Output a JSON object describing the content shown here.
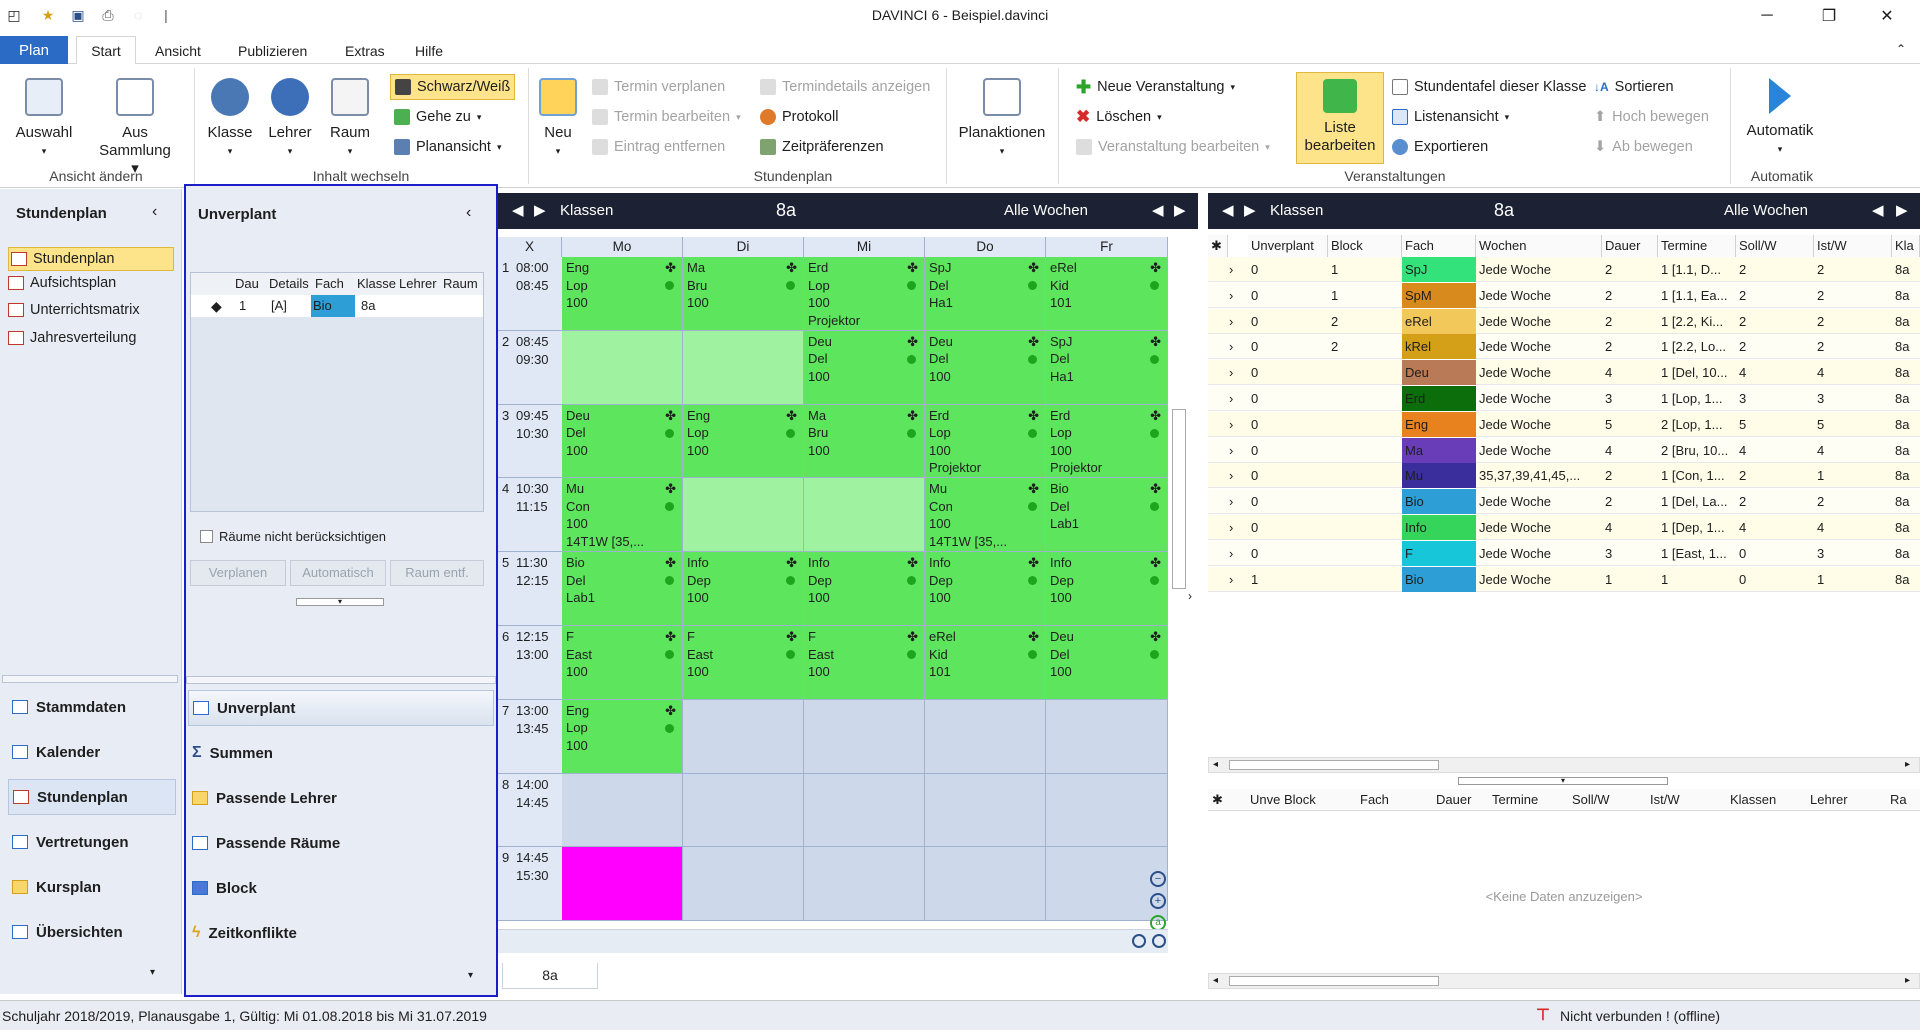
{
  "window": {
    "title": "DAVINCI 6 - Beispiel.davinci"
  },
  "tabs": {
    "plan": "Plan",
    "start": "Start",
    "ansicht": "Ansicht",
    "publizieren": "Publizieren",
    "extras": "Extras",
    "hilfe": "Hilfe"
  },
  "ribbon": {
    "auswahl": "Auswahl",
    "aus_sammlung_1": "Aus",
    "aus_sammlung_2": "Sammlung",
    "group1": "Ansicht ändern",
    "klasse": "Klasse",
    "lehrer": "Lehrer",
    "raum": "Raum",
    "schwarzweiss": "Schwarz/Weiß",
    "gehezu": "Gehe zu",
    "planansicht": "Planansicht",
    "group2": "Inhalt wechseln",
    "neu": "Neu",
    "termin_verplanen": "Termin verplanen",
    "termin_bearbeiten": "Termin bearbeiten",
    "eintrag_entfernen": "Eintrag entfernen",
    "termindetails": "Termindetails anzeigen",
    "protokoll": "Protokoll",
    "zeitpraeferenzen": "Zeitpräferenzen",
    "planaktionen": "Planaktionen",
    "group3": "Stundenplan",
    "neue_veranstaltung": "Neue Veranstaltung",
    "loeschen": "Löschen",
    "veranstaltung_bearbeiten": "Veranstaltung bearbeiten",
    "liste_1": "Liste",
    "liste_2": "bearbeiten",
    "stundentafel": "Stundentafel dieser Klasse",
    "listenansicht": "Listenansicht",
    "exportieren": "Exportieren",
    "sortieren": "Sortieren",
    "hoch": "Hoch bewegen",
    "ab": "Ab bewegen",
    "group4": "Veranstaltungen",
    "automatik": "Automatik",
    "group5": "Automatik"
  },
  "leftnav": {
    "header": "Stundenplan",
    "items": [
      "Stundenplan",
      "Aufsichtsplan",
      "Unterrichtsmatrix",
      "Jahresverteilung"
    ],
    "modules": [
      "Stammdaten",
      "Kalender",
      "Stundenplan",
      "Vertretungen",
      "Kursplan",
      "Übersichten"
    ]
  },
  "unverplant": {
    "header": "Unverplant",
    "columns": [
      "Dau",
      "Details",
      "Fach",
      "Klasse",
      "Lehrer",
      "Raum"
    ],
    "row": {
      "dau": "1",
      "details": "[A]",
      "fach": "Bio",
      "klasse": "8a"
    },
    "checkbox": "Räume nicht berücksichtigen",
    "btn_verplanen": "Verplanen",
    "btn_automatisch": "Automatisch",
    "btn_raum": "Raum entf.",
    "sections": [
      "Unverplant",
      "Summen",
      "Passende Lehrer",
      "Passende Räume",
      "Block",
      "Zeitkonflikte"
    ]
  },
  "grid": {
    "header_left": "Klassen",
    "header_center": "8a",
    "header_right": "Alle Wochen",
    "col_x": "X",
    "days": [
      "Mo",
      "Di",
      "Mi",
      "Do",
      "Fr"
    ],
    "rows": [
      {
        "n": "1",
        "start": "08:00",
        "end": "08:45"
      },
      {
        "n": "2",
        "start": "08:45",
        "end": "09:30"
      },
      {
        "n": "3",
        "start": "09:45",
        "end": "10:30"
      },
      {
        "n": "4",
        "start": "10:30",
        "end": "11:15"
      },
      {
        "n": "5",
        "start": "11:30",
        "end": "12:15"
      },
      {
        "n": "6",
        "start": "12:15",
        "end": "13:00"
      },
      {
        "n": "7",
        "start": "13:00",
        "end": "13:45"
      },
      {
        "n": "8",
        "start": "14:00",
        "end": "14:45"
      },
      {
        "n": "9",
        "start": "14:45",
        "end": "15:30"
      }
    ],
    "footer_tab": "8a",
    "lessons": {
      "mo1": [
        "Eng",
        "Lop",
        "100"
      ],
      "di1": [
        "Ma",
        "Bru",
        "100"
      ],
      "mi1": [
        "Erd",
        "Lop",
        "100",
        "Projektor"
      ],
      "do1": [
        "SpJ",
        "Del",
        "Ha1"
      ],
      "fr1": [
        "eRel",
        "Kid",
        "101"
      ],
      "mi2": [
        "Deu",
        "Del",
        "100"
      ],
      "do2": [
        "Deu",
        "Del",
        "100"
      ],
      "fr2": [
        "SpJ",
        "Del",
        "Ha1"
      ],
      "mo3": [
        "Deu",
        "Del",
        "100"
      ],
      "di3": [
        "Eng",
        "Lop",
        "100"
      ],
      "mi3": [
        "Ma",
        "Bru",
        "100"
      ],
      "do3": [
        "Erd",
        "Lop",
        "100",
        "Projektor"
      ],
      "fr3": [
        "Erd",
        "Lop",
        "100",
        "Projektor"
      ],
      "mo4": [
        "Mu",
        "Con",
        "100",
        "14T1W [35,..."
      ],
      "do4": [
        "Mu",
        "Con",
        "100",
        "14T1W [35,..."
      ],
      "fr4": [
        "Bio",
        "Del",
        "Lab1"
      ],
      "mo5": [
        "Bio",
        "Del",
        "Lab1"
      ],
      "di5": [
        "Info",
        "Dep",
        "100"
      ],
      "mi5": [
        "Info",
        "Dep",
        "100"
      ],
      "do5": [
        "Info",
        "Dep",
        "100"
      ],
      "fr5": [
        "Info",
        "Dep",
        "100"
      ],
      "mo6": [
        "F",
        "East",
        "100"
      ],
      "di6": [
        "F",
        "East",
        "100"
      ],
      "mi6": [
        "F",
        "East",
        "100"
      ],
      "do6": [
        "eRel",
        "Kid",
        "101"
      ],
      "fr6": [
        "Deu",
        "Del",
        "100"
      ],
      "mo7": [
        "Eng",
        "Lop",
        "100"
      ]
    }
  },
  "rightpanel": {
    "header_left": "Klassen",
    "header_center": "8a",
    "header_right": "Alle Wochen",
    "columns": [
      "Unverplant",
      "Block",
      "Fach",
      "Wochen",
      "Dauer",
      "Termine",
      "Soll/W",
      "Ist/W",
      "Kla"
    ],
    "rows": [
      {
        "u": "0",
        "block": "1",
        "fach": "SpJ",
        "color": "#33e27a",
        "wochen": "Jede Woche",
        "dauer": "2",
        "termine": "1 [1.1, D...",
        "soll": "2",
        "ist": "2",
        "kl": "8a"
      },
      {
        "u": "0",
        "block": "1",
        "fach": "SpM",
        "color": "#d98a1c",
        "wochen": "Jede Woche",
        "dauer": "2",
        "termine": "1 [1.1, Ea...",
        "soll": "2",
        "ist": "2",
        "kl": "8a"
      },
      {
        "u": "0",
        "block": "2",
        "fach": "eRel",
        "color": "#f3c85a",
        "wochen": "Jede Woche",
        "dauer": "2",
        "termine": "1 [2.2, Ki...",
        "soll": "2",
        "ist": "2",
        "kl": "8a"
      },
      {
        "u": "0",
        "block": "2",
        "fach": "kRel",
        "color": "#d4a017",
        "wochen": "Jede Woche",
        "dauer": "2",
        "termine": "1 [2.2, Lo...",
        "soll": "2",
        "ist": "2",
        "kl": "8a"
      },
      {
        "u": "0",
        "block": "",
        "fach": "Deu",
        "color": "#b97a57",
        "wochen": "Jede Woche",
        "dauer": "4",
        "termine": "1 [Del, 10...",
        "soll": "4",
        "ist": "4",
        "kl": "8a"
      },
      {
        "u": "0",
        "block": "",
        "fach": "Erd",
        "color": "#0b6e0b",
        "wochen": "Jede Woche",
        "dauer": "3",
        "termine": "1 [Lop, 1...",
        "soll": "3",
        "ist": "3",
        "kl": "8a"
      },
      {
        "u": "0",
        "block": "",
        "fach": "Eng",
        "color": "#e8821e",
        "wochen": "Jede Woche",
        "dauer": "5",
        "termine": "2 [Lop, 1...",
        "soll": "5",
        "ist": "5",
        "kl": "8a"
      },
      {
        "u": "0",
        "block": "",
        "fach": "Ma",
        "color": "#6a3db8",
        "wochen": "Jede Woche",
        "dauer": "4",
        "termine": "2 [Bru, 10...",
        "soll": "4",
        "ist": "4",
        "kl": "8a"
      },
      {
        "u": "0",
        "block": "",
        "fach": "Mu",
        "color": "#3a2d9c",
        "wochen": "35,37,39,41,45,...",
        "dauer": "2",
        "termine": "1 [Con, 1...",
        "soll": "2",
        "ist": "1",
        "kl": "8a"
      },
      {
        "u": "0",
        "block": "",
        "fach": "Bio",
        "color": "#2e9fd6",
        "wochen": "Jede Woche",
        "dauer": "2",
        "termine": "1 [Del, La...",
        "soll": "2",
        "ist": "2",
        "kl": "8a"
      },
      {
        "u": "0",
        "block": "",
        "fach": "Info",
        "color": "#35d45a",
        "wochen": "Jede Woche",
        "dauer": "4",
        "termine": "1 [Dep, 1...",
        "soll": "4",
        "ist": "4",
        "kl": "8a"
      },
      {
        "u": "0",
        "block": "",
        "fach": "F",
        "color": "#17c6d8",
        "wochen": "Jede Woche",
        "dauer": "3",
        "termine": "1 [East, 1...",
        "soll": "0",
        "ist": "3",
        "kl": "8a"
      },
      {
        "u": "1",
        "block": "",
        "fach": "Bio",
        "color": "#2e9fd6",
        "wochen": "Jede Woche",
        "dauer": "1",
        "termine": "1",
        "soll": "0",
        "ist": "1",
        "kl": "8a"
      }
    ],
    "lower_columns": [
      "Unve",
      "Block",
      "Fach",
      "Dauer",
      "Termine",
      "Soll/W",
      "Ist/W",
      "Klassen",
      "Lehrer",
      "Ra"
    ],
    "nodata": "<Keine Daten anzuzeigen>"
  },
  "status": {
    "left": "Schuljahr 2018/2019, Planausgabe 1, Gültig: Mi 01.08.2018 bis Mi 31.07.2019",
    "right": "Nicht verbunden ! (offline)"
  },
  "colors": {
    "accent": "#2b6bc6",
    "lesson_green": "#5de55d",
    "magenta": "#ff00ff",
    "selection_border": "#1c1cc8"
  }
}
